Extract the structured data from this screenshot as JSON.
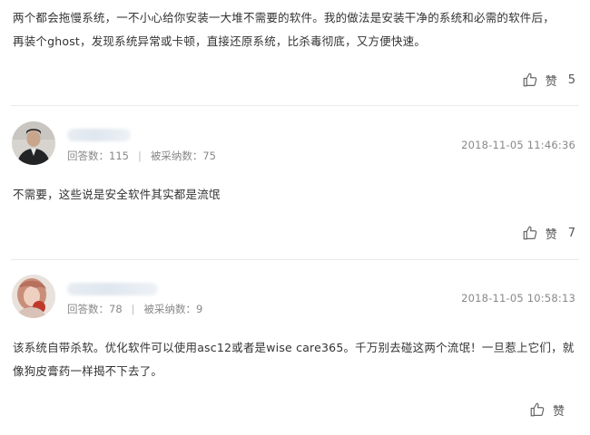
{
  "answers": [
    {
      "text_lines": [
        "两个都会拖慢系统，一不小心给你安装一大堆不需要的软件。我的做法是安装干净的系统和必需的软件后，",
        "再装个ghost，发现系统异常或卡顿，直接还原系统，比杀毒彻底，又方便快速。"
      ],
      "like_label": "赞",
      "like_count": "5"
    },
    {
      "user": {
        "answers_label": "回答数：",
        "answers_count": "115",
        "adopted_label": "被采纳数：",
        "adopted_count": "75",
        "separator": "|"
      },
      "timestamp": "2018-11-05 11:46:36",
      "text_lines": [
        "不需要，这些说是安全软件其实都是流氓"
      ],
      "like_label": "赞",
      "like_count": "7"
    },
    {
      "user": {
        "answers_label": "回答数：",
        "answers_count": "78",
        "adopted_label": "被采纳数：",
        "adopted_count": "9",
        "separator": "|"
      },
      "timestamp": "2018-11-05 10:58:13",
      "text_lines": [
        "该系统自带杀软。优化软件可以使用asc12或者是wise care365。千万别去碰这两个流氓！一旦惹上它们，就",
        "像狗皮膏药一样揭不下去了。"
      ],
      "like_label": "赞",
      "like_count": ""
    }
  ],
  "icons": {
    "like": "thumbs-up-icon"
  },
  "colors": {
    "text": "#333333",
    "meta": "#888888",
    "divider": "#ebebeb"
  }
}
